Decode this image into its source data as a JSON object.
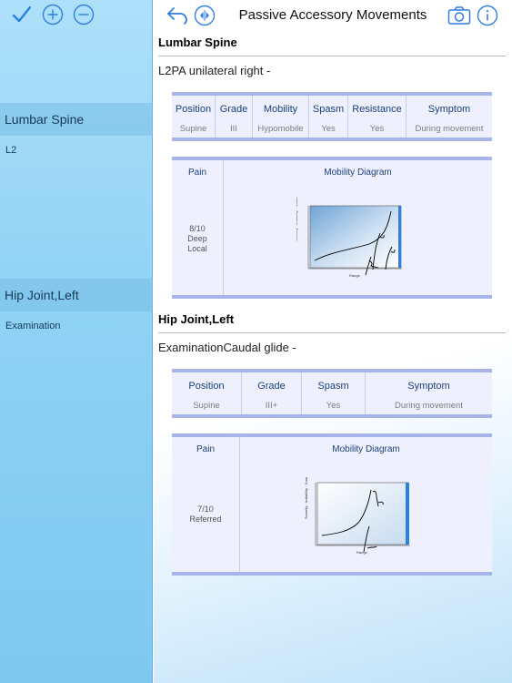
{
  "sidebar": {
    "toolbar": {
      "icons": [
        "checkmark-icon",
        "plus-circle-icon",
        "minus-circle-icon"
      ]
    },
    "sections": [
      {
        "title": "Lumbar Spine",
        "items": [
          "L2"
        ]
      },
      {
        "title": "Hip Joint,Left",
        "items": [
          "Examination"
        ]
      }
    ]
  },
  "navbar": {
    "title": "Passive Accessory Movements",
    "icons": [
      "undo-icon",
      "split-view-icon",
      "camera-icon",
      "info-icon"
    ],
    "accent": "#2f7fe0"
  },
  "records": [
    {
      "title": "Lumbar Spine",
      "description": "L2PA unilateral right -",
      "columns": [
        "Position",
        "Grade",
        "Mobility",
        "Spasm",
        "Resistance",
        "Symptom"
      ],
      "values": [
        "Supine",
        "III",
        "Hypomobile",
        "Yes",
        "Yes",
        "During movement"
      ],
      "pain_label": "Pain",
      "pain_lines": [
        "8/10",
        "Deep",
        "Local"
      ],
      "diagram_label": "Mobility Diagram"
    },
    {
      "title": "Hip Joint,Left",
      "description": "ExaminationCaudal glide -",
      "columns": [
        "Position",
        "Grade",
        "Spasm",
        "Symptom"
      ],
      "values": [
        "Supine",
        "III+",
        "Yes",
        "During movement"
      ],
      "pain_label": "Pain",
      "pain_lines": [
        "7/10",
        "Referred"
      ],
      "diagram_label": "Mobility Diagram"
    }
  ],
  "colors": {
    "table_border": "#a6b4ea",
    "table_bg": "#eef1fd",
    "header_text": "#1c3f7a",
    "sidebar": "#8fd2f4"
  }
}
